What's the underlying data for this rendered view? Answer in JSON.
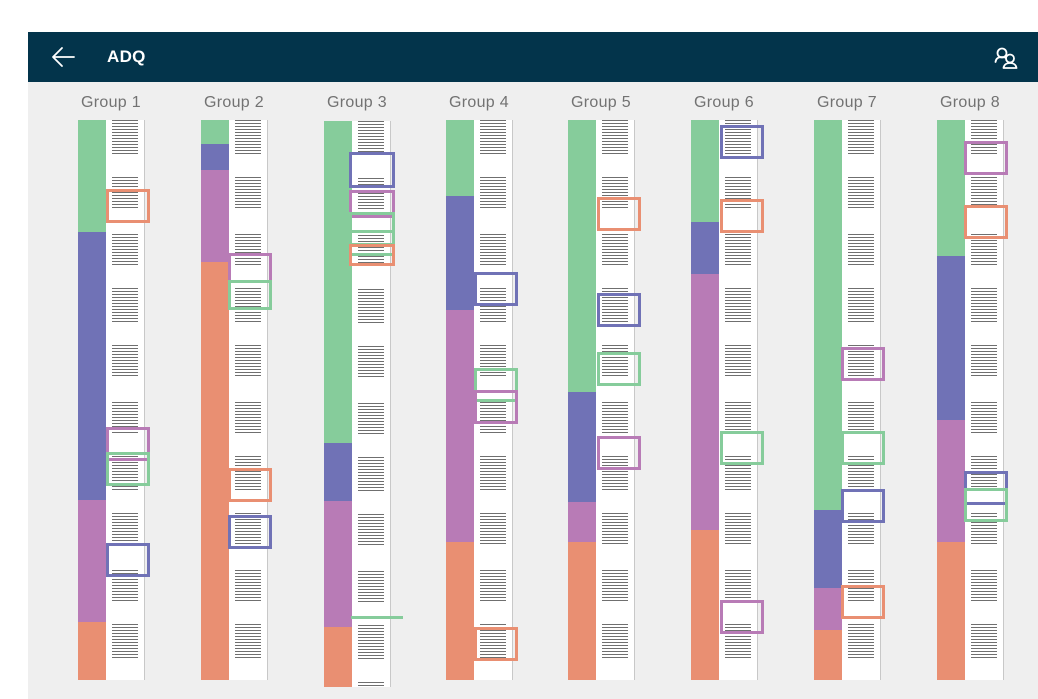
{
  "app": {
    "title": "ADQ",
    "back_icon": "arrow-left-icon",
    "users_icon": "users-icon"
  },
  "colors": {
    "header": "#03344b",
    "background": "#efefef",
    "green": "#86cc9b",
    "blue": "#7072b6",
    "purple": "#b87bb6",
    "orange": "#e98f72"
  },
  "groups": [
    {
      "label": "Group 1"
    },
    {
      "label": "Group 2"
    },
    {
      "label": "Group 3"
    },
    {
      "label": "Group 4"
    },
    {
      "label": "Group 5"
    },
    {
      "label": "Group 6"
    },
    {
      "label": "Group 7"
    },
    {
      "label": "Group 8"
    }
  ]
}
